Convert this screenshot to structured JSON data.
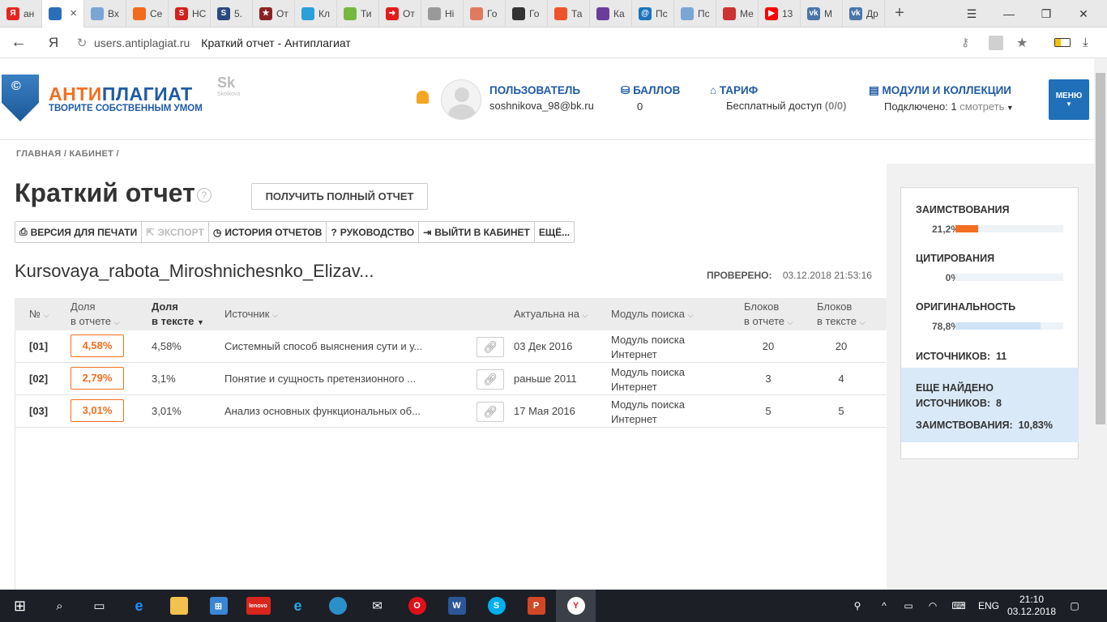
{
  "browser": {
    "tabs": [
      {
        "label": "ан",
        "icon": "yandex",
        "color": "#e52620",
        "icon_text": "Я"
      },
      {
        "label": "",
        "icon": "antiplagiat-shield",
        "color": "#2a6fb9",
        "icon_text": "",
        "active": true
      },
      {
        "label": "Вх",
        "icon": "document",
        "color": "#7aa6d6",
        "icon_text": ""
      },
      {
        "label": "Се",
        "icon": "squirrel",
        "color": "#f26b1d",
        "icon_text": ""
      },
      {
        "label": "НС",
        "icon": "s-red",
        "color": "#d3211e",
        "icon_text": "S"
      },
      {
        "label": "5.",
        "icon": "s-blue",
        "color": "#2b4a7e",
        "icon_text": "S"
      },
      {
        "label": "От",
        "icon": "star-badge",
        "color": "#8b2222",
        "icon_text": "★"
      },
      {
        "label": "Кл",
        "icon": "kl",
        "color": "#2aa0d8",
        "icon_text": ""
      },
      {
        "label": "Ти",
        "icon": "runner",
        "color": "#74b842",
        "icon_text": ""
      },
      {
        "label": "От",
        "icon": "arrow-red",
        "color": "#e21b1b",
        "icon_text": "➜"
      },
      {
        "label": "Hi",
        "icon": "hi",
        "color": "#999999",
        "icon_text": ""
      },
      {
        "label": "Го",
        "icon": "house",
        "color": "#e07a5f",
        "icon_text": ""
      },
      {
        "label": "Го",
        "icon": "tripadvisor",
        "color": "#333333",
        "icon_text": ""
      },
      {
        "label": "Та",
        "icon": "ta",
        "color": "#f0532c",
        "icon_text": ""
      },
      {
        "label": "Ка",
        "icon": "book",
        "color": "#6a3d9a",
        "icon_text": ""
      },
      {
        "label": "Пс",
        "icon": "mail-at",
        "color": "#1b75bc",
        "icon_text": "@"
      },
      {
        "label": "Пс",
        "icon": "document",
        "color": "#7aa6d6",
        "icon_text": ""
      },
      {
        "label": "Ме",
        "icon": "mc",
        "color": "#cc3333",
        "icon_text": ""
      },
      {
        "label": "13",
        "icon": "youtube",
        "color": "#ff0000",
        "icon_text": "▶"
      },
      {
        "label": "М",
        "icon": "vk",
        "color": "#4a76a8",
        "icon_text": "vk"
      },
      {
        "label": "Др",
        "icon": "vk",
        "color": "#4a76a8",
        "icon_text": "vk"
      }
    ],
    "url": "users.antiplagiat.ru",
    "page_title": "Краткий отчет - Антиплагиат"
  },
  "header": {
    "logo_anti": "АНТИ",
    "logo_plag": "ПЛАГИАТ",
    "logo_sub": "ТВОРИТЕ СОБСТВЕННЫМ УМОМ",
    "skolkovo": "Sk",
    "skolkovo_sub": "Skolkovo",
    "user_label": "ПОЛЬЗОВАТЕЛЬ",
    "user_email": "soshnikova_98@bk.ru",
    "points_label": "БАЛЛОВ",
    "points_value": "0",
    "tariff_label": "ТАРИФ",
    "tariff_value": "Бесплатный доступ",
    "tariff_count": "(0/0)",
    "modules_label": "МОДУЛИ И КОЛЛЕКЦИИ",
    "modules_value": "Подключено: 1",
    "modules_link": "смотреть",
    "menu_label": "МЕНЮ"
  },
  "breadcrumb": "ГЛАВНАЯ / КАБИНЕТ /",
  "page": {
    "title": "Краткий отчет",
    "full_report_button": "ПОЛУЧИТЬ ПОЛНЫЙ ОТЧЕТ",
    "toolbar": {
      "print": "ВЕРСИЯ ДЛЯ ПЕЧАТИ",
      "export": "ЭКСПОРТ",
      "history": "ИСТОРИЯ ОТЧЕТОВ",
      "guide": "РУКОВОДСТВО",
      "exit": "ВЫЙТИ В КАБИНЕТ",
      "more": "ЕЩЁ..."
    },
    "document_name": "Kursovaya_rabota_Miroshnichesnko_Elizav...",
    "checked_label": "ПРОВЕРЕНО:",
    "checked_date": "03.12.2018 21:53:16"
  },
  "table": {
    "headers": {
      "num": "№",
      "share_report_1": "Доля",
      "share_report_2": "в отчете",
      "share_text_1": "Доля",
      "share_text_2": "в тексте",
      "source": "Источник",
      "actual": "Актуальна на",
      "module": "Модуль поиска",
      "blocks_report_1": "Блоков",
      "blocks_report_2": "в отчете",
      "blocks_text_1": "Блоков",
      "blocks_text_2": "в тексте"
    },
    "rows": [
      {
        "num": "[01]",
        "share_report": "4,58%",
        "share_text": "4,58%",
        "source": "Системный способ выяснения сути и у...",
        "actual": "03 Дек 2016",
        "module_1": "Модуль поиска",
        "module_2": "Интернет",
        "blocks_report": "20",
        "blocks_text": "20"
      },
      {
        "num": "[02]",
        "share_report": "2,79%",
        "share_text": "3,1%",
        "source": "Понятие и сущность претензионного ...",
        "actual": "раньше 2011",
        "module_1": "Модуль поиска",
        "module_2": "Интернет",
        "blocks_report": "3",
        "blocks_text": "4"
      },
      {
        "num": "[03]",
        "share_report": "3,01%",
        "share_text": "3,01%",
        "source": "Анализ основных функциональных об...",
        "actual": "17 Мая 2016",
        "module_1": "Модуль поиска",
        "module_2": "Интернет",
        "blocks_report": "5",
        "blocks_text": "5"
      }
    ]
  },
  "stats": {
    "borrow_label": "ЗАИМСТВОВАНИЯ",
    "borrow_value": "21,2%",
    "borrow_fraction": 0.212,
    "borrow_color": "#f36f21",
    "cite_label": "ЦИТИРОВАНИЯ",
    "cite_value": "0%",
    "cite_fraction": 0,
    "orig_label": "ОРИГИНАЛЬНОСТЬ",
    "orig_value": "78,8%",
    "orig_fraction": 0.788,
    "orig_color": "#cfe3f5",
    "sources_label": "ИСТОЧНИКОВ:",
    "sources_value": "11",
    "more_found_1": "ЕЩЕ НАЙДЕНО",
    "more_found_2": "ИСТОЧНИКОВ:",
    "more_found_value": "8",
    "more_borrow_label": "ЗАИМСТВОВАНИЯ:",
    "more_borrow_value": "10,83%"
  },
  "taskbar": {
    "lang": "ENG",
    "time": "21:10",
    "date": "03.12.2018"
  }
}
